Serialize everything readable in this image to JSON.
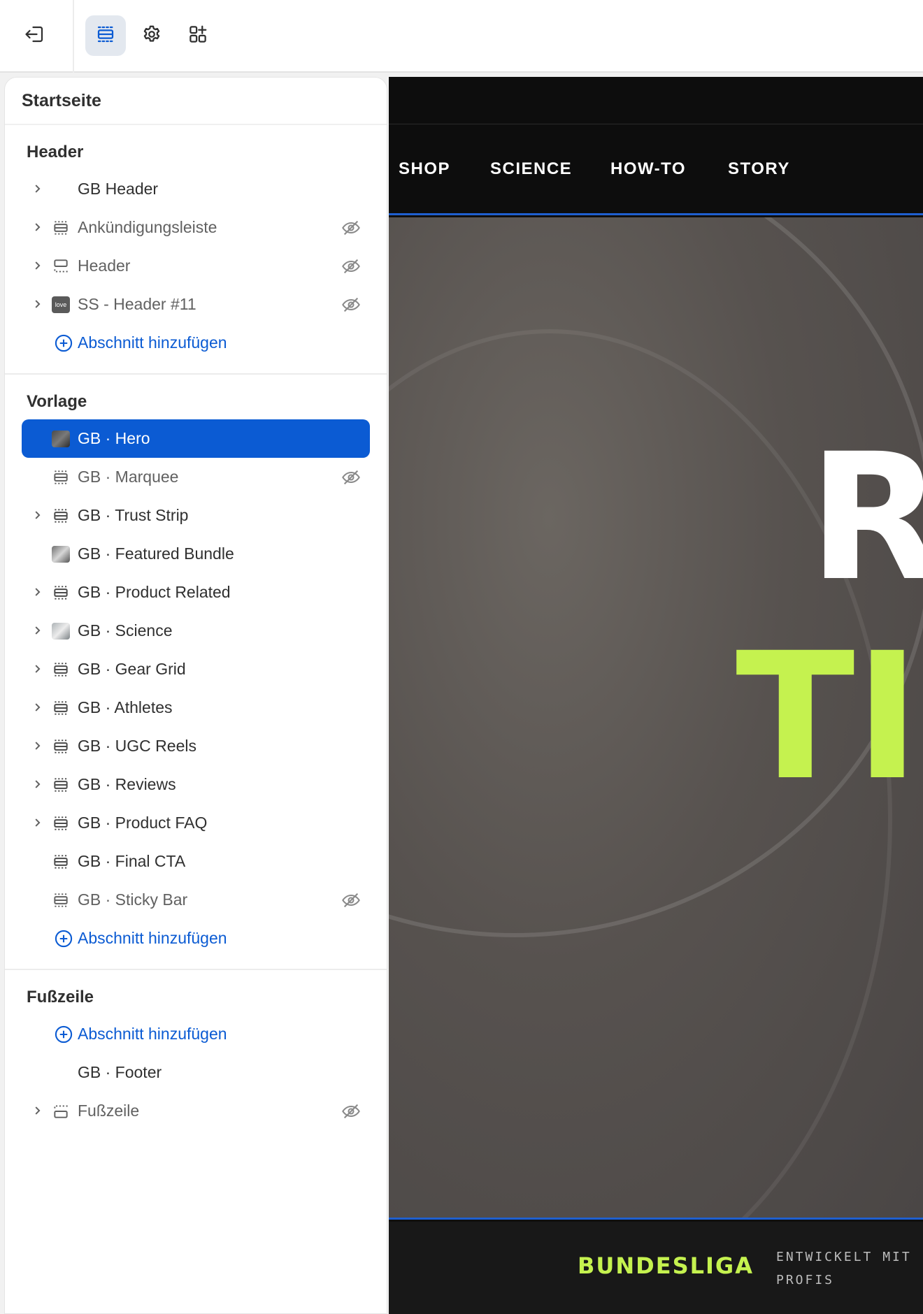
{
  "toolbar": {
    "exit_icon": "exit-icon",
    "tools": [
      {
        "icon": "sections-icon",
        "active": true
      },
      {
        "icon": "gear-icon",
        "active": false
      },
      {
        "icon": "add-app-icon",
        "active": false
      }
    ]
  },
  "sidebar": {
    "title": "Startseite",
    "groups": {
      "header": {
        "heading": "Header",
        "items": [
          {
            "label": "GB Header"
          },
          {
            "label": "Ankündigungsleiste"
          },
          {
            "label": "Header"
          },
          {
            "label": "SS - Header #11",
            "thumb_text": "love"
          }
        ],
        "add_label": "Abschnitt hinzufügen"
      },
      "template": {
        "heading": "Vorlage",
        "items": [
          {
            "label": "GB · Hero"
          },
          {
            "label": "GB · Marquee"
          },
          {
            "label": "GB · Trust Strip"
          },
          {
            "label": "GB · Featured Bundle"
          },
          {
            "label": "GB · Product Related"
          },
          {
            "label": "GB · Science"
          },
          {
            "label": "GB · Gear Grid"
          },
          {
            "label": "GB · Athletes"
          },
          {
            "label": "GB · UGC Reels"
          },
          {
            "label": "GB · Reviews"
          },
          {
            "label": "GB · Product FAQ"
          },
          {
            "label": "GB · Final CTA"
          },
          {
            "label": "GB · Sticky Bar"
          }
        ],
        "add_label": "Abschnitt hinzufügen"
      },
      "footer": {
        "heading": "Fußzeile",
        "add_label": "Abschnitt hinzufügen",
        "items": [
          {
            "label": "GB · Footer"
          },
          {
            "label": "Fußzeile"
          }
        ]
      }
    }
  },
  "preview": {
    "nav_links": [
      "SHOP",
      "SCIENCE",
      "HOW-TO",
      "STORY"
    ],
    "hero_line1": "R",
    "hero_line2": "TI",
    "strip_brand": "BUNDESLIGA",
    "strip_claim": "ENTWICKELT MIT PROFIS"
  },
  "colors": {
    "accent_blue": "#0b5bd3",
    "neon_green": "#c5f24f",
    "selection_outline": "#1f5fcf"
  }
}
